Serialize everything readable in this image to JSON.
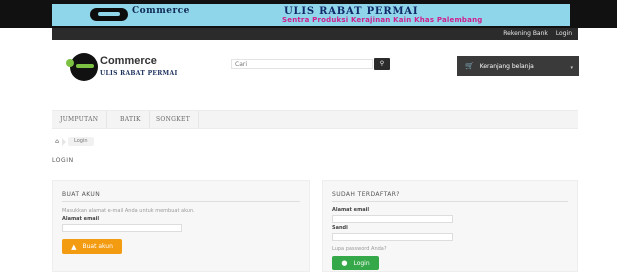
{
  "banner": {
    "brand_word": "Commerce",
    "title": "ULIS RABAT PERMAI",
    "subtitle": "Sentra Produksi Kerajinan Kain Khas Palembang"
  },
  "userbar": {
    "links": [
      "Rekening Bank",
      "Login"
    ]
  },
  "header": {
    "logo_line1": "Commerce",
    "logo_line2": "ULIS RABAT PERMAI",
    "search_placeholder": "Cari",
    "search_button_icon": "search-icon",
    "cart_label": "Keranjang belanja",
    "cart_icon": "cart-icon"
  },
  "nav": {
    "items": [
      "JUMPUTAN",
      "BATIK",
      "SONGKET"
    ]
  },
  "breadcrumb": {
    "home_icon": "home-icon",
    "current": "Login"
  },
  "page": {
    "heading": "LOGIN"
  },
  "create_account": {
    "title": "BUAT AKUN",
    "instruction": "Masukkan alamat e-mail Anda untuk membuat akun.",
    "email_label": "Alamat email",
    "button_label": "Buat akun",
    "button_icon": "user-icon"
  },
  "login": {
    "title": "SUDAH TERDAFTAR?",
    "email_label": "Alamat email",
    "password_label": "Sandi",
    "forgot_label": "Lupa password Anda?",
    "button_label": "Login",
    "button_icon": "lock-icon"
  },
  "colors": {
    "orange": "#f39c12",
    "green": "#35a849",
    "dark": "#2b2b2b",
    "banner": "#8fd6ea"
  }
}
